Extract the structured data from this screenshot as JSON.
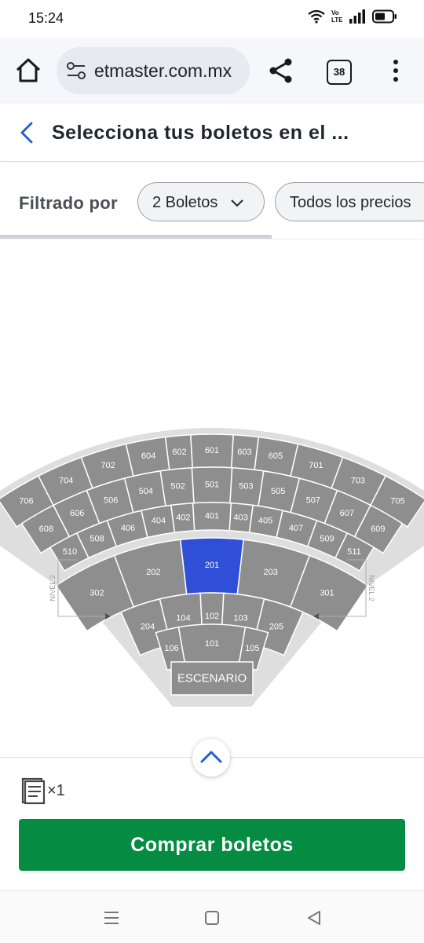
{
  "status": {
    "time": "15:24",
    "volte": "Vo LTE",
    "battery_level": 0.6
  },
  "browser": {
    "url": "etmaster.com.mx",
    "tab_count": "38"
  },
  "header": {
    "title": "Selecciona tus boletos en el ..."
  },
  "filters": {
    "label": "Filtrado por",
    "chips": [
      {
        "label": "2 Boletos"
      },
      {
        "label": "Todos los precios"
      }
    ]
  },
  "map": {
    "stage_label": "ESCENARIO",
    "level_label": "NIVEL 2",
    "selected_color": "#2e4fd6",
    "section_color": "#8e8e8e",
    "sections": [
      {
        "id": "706"
      },
      {
        "id": "704"
      },
      {
        "id": "702"
      },
      {
        "id": "604"
      },
      {
        "id": "602"
      },
      {
        "id": "601"
      },
      {
        "id": "603"
      },
      {
        "id": "605"
      },
      {
        "id": "701"
      },
      {
        "id": "703"
      },
      {
        "id": "705"
      },
      {
        "id": "608"
      },
      {
        "id": "606"
      },
      {
        "id": "506"
      },
      {
        "id": "504"
      },
      {
        "id": "502"
      },
      {
        "id": "501"
      },
      {
        "id": "503"
      },
      {
        "id": "505"
      },
      {
        "id": "507"
      },
      {
        "id": "607"
      },
      {
        "id": "609"
      },
      {
        "id": "510"
      },
      {
        "id": "508"
      },
      {
        "id": "406"
      },
      {
        "id": "404"
      },
      {
        "id": "402"
      },
      {
        "id": "401"
      },
      {
        "id": "403"
      },
      {
        "id": "405"
      },
      {
        "id": "407"
      },
      {
        "id": "509"
      },
      {
        "id": "511"
      },
      {
        "id": "302"
      },
      {
        "id": "202"
      },
      {
        "id": "201",
        "selected": true
      },
      {
        "id": "203"
      },
      {
        "id": "301"
      },
      {
        "id": "204"
      },
      {
        "id": "104"
      },
      {
        "id": "102"
      },
      {
        "id": "103"
      },
      {
        "id": "205"
      },
      {
        "id": "106"
      },
      {
        "id": "101"
      },
      {
        "id": "105"
      }
    ]
  },
  "cart": {
    "count_label": "×1",
    "buy_label": "Comprar boletos"
  },
  "icons": {
    "home": "home-icon",
    "settings": "site-settings-icon",
    "share": "share-icon",
    "menu": "more-vert-icon",
    "back": "chevron-left-icon",
    "expand": "chevron-up-icon",
    "ticket": "ticket-icon"
  }
}
